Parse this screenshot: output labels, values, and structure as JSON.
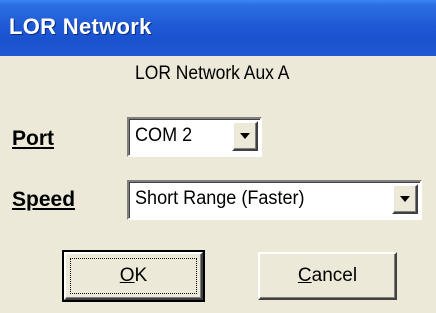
{
  "window": {
    "title": "LOR Network"
  },
  "header": {
    "subtitle": "LOR Network Aux A"
  },
  "port": {
    "label": "Port",
    "value": "COM 2"
  },
  "speed": {
    "label": "Speed",
    "value": "Short Range (Faster)"
  },
  "buttons": {
    "ok_mnemonic": "O",
    "ok_rest": "K",
    "cancel_mnemonic": "C",
    "cancel_rest": "ancel"
  },
  "icons": {
    "dropdown": "chevron-down-icon"
  },
  "colors": {
    "titlebar": "#1f5ad6",
    "window_bg": "#ece9d8",
    "title_text": "#ffffff"
  }
}
